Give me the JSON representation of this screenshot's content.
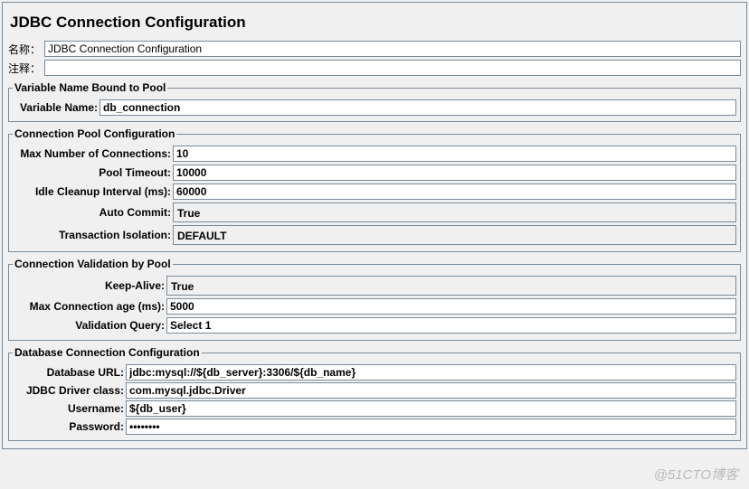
{
  "title": "JDBC Connection Configuration",
  "header": {
    "name_label": "名称：",
    "name_value": "JDBC Connection Configuration",
    "comment_label": "注释：",
    "comment_value": ""
  },
  "group_variable": {
    "legend": "Variable Name Bound to Pool",
    "var_label": "Variable Name:",
    "var_value": "db_connection"
  },
  "group_pool": {
    "legend": "Connection Pool Configuration",
    "max_conn_label": "Max Number of Connections:",
    "max_conn_value": "10",
    "pool_timeout_label": "Pool Timeout:",
    "pool_timeout_value": "10000",
    "idle_cleanup_label": "Idle Cleanup Interval (ms):",
    "idle_cleanup_value": "60000",
    "auto_commit_label": "Auto Commit:",
    "auto_commit_value": "True",
    "txn_iso_label": "Transaction Isolation:",
    "txn_iso_value": "DEFAULT"
  },
  "group_validation": {
    "legend": "Connection Validation by Pool",
    "keep_alive_label": "Keep-Alive:",
    "keep_alive_value": "True",
    "max_age_label": "Max Connection age (ms):",
    "max_age_value": "5000",
    "validation_query_label": "Validation Query:",
    "validation_query_value": "Select 1"
  },
  "group_db": {
    "legend": "Database Connection Configuration",
    "url_label": "Database URL:",
    "url_value": "jdbc:mysql://${db_server}:3306/${db_name}",
    "driver_label": "JDBC Driver class:",
    "driver_value": "com.mysql.jdbc.Driver",
    "user_label": "Username:",
    "user_value": "${db_user}",
    "pass_label": "Password:",
    "pass_value": "••••••••"
  },
  "watermark": "@51CTO博客"
}
